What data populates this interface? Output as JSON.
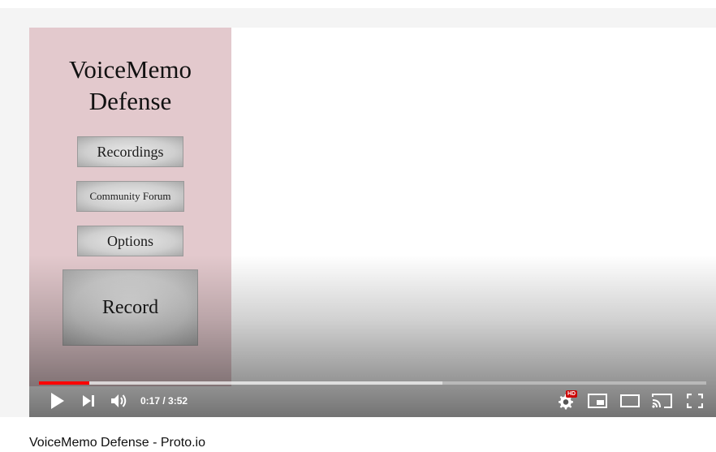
{
  "app": {
    "title": "VoiceMemo Defense",
    "buttons": {
      "recordings": "Recordings",
      "community_forum": "Community Forum",
      "options": "Options",
      "record": "Record"
    }
  },
  "player": {
    "time_current": "0:17",
    "time_separator": " / ",
    "time_total": "3:52",
    "progress_played_fraction": 0.075,
    "progress_loaded_fraction": 0.605,
    "settings_badge": "HD"
  },
  "video": {
    "title": "VoiceMemo Defense - Proto.io"
  },
  "colors": {
    "app_panel_bg": "#e3c9cd",
    "progress_played": "#ff0000"
  },
  "icons": [
    "play-icon",
    "next-icon",
    "volume-icon",
    "settings-icon",
    "miniplayer-icon",
    "theater-mode-icon",
    "cast-icon",
    "fullscreen-icon"
  ]
}
